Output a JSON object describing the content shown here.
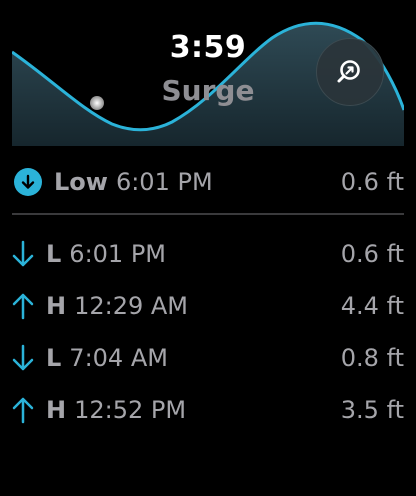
{
  "header": {
    "time": "3:59",
    "station": "Surge",
    "zoom_icon": "magnifier-arrow-icon"
  },
  "current_tide": {
    "type": "Low",
    "time": "6:01 PM",
    "height": "0.6 ft",
    "icon": "down-arrow-circle-icon"
  },
  "tides": [
    {
      "type": "L",
      "time": "6:01 PM",
      "height": "0.6 ft",
      "direction": "down"
    },
    {
      "type": "H",
      "time": "12:29 AM",
      "height": "4.4 ft",
      "direction": "up"
    },
    {
      "type": "L",
      "time": "7:04 AM",
      "height": "0.8 ft",
      "direction": "down"
    },
    {
      "type": "H",
      "time": "12:52 PM",
      "height": "3.5 ft",
      "direction": "up"
    }
  ],
  "colors": {
    "accent": "#2bb3d9",
    "secondary_text": "#a5a5aa",
    "background": "#000000"
  }
}
